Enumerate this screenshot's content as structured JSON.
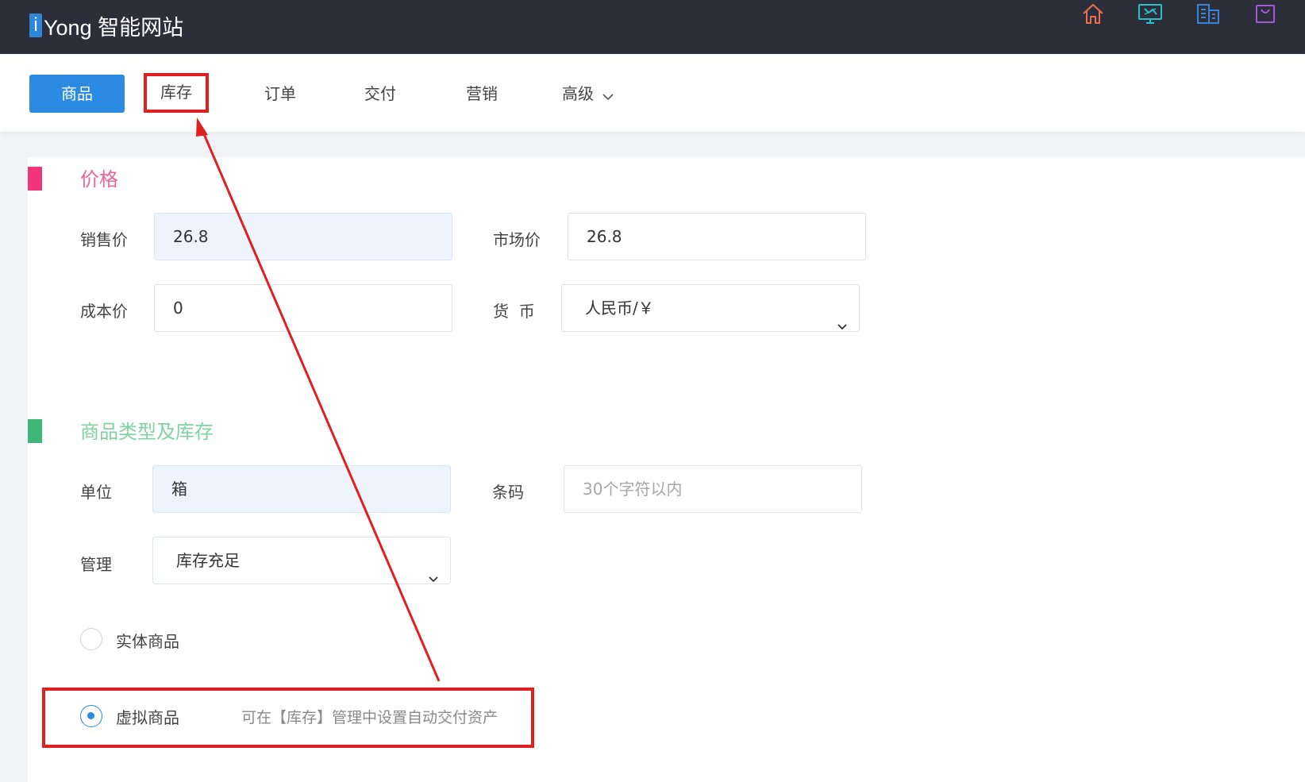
{
  "brand": {
    "logo_letter": "i",
    "name": "Yong 智能网站"
  },
  "top_icons": [
    "home-icon",
    "dashboard-monitor-icon",
    "building-icon",
    "shopping-bag-icon"
  ],
  "colors": {
    "topbar": "#2c2e3a",
    "accent": "#2b8be2",
    "price_section": "#f0357a",
    "stock_section": "#3cb878",
    "price_title": "#e8669a",
    "stock_title": "#7fd3a2",
    "annotation": "#e02020"
  },
  "nav": {
    "tabs": [
      {
        "label": "商品",
        "active": true
      },
      {
        "label": "库存",
        "active": false
      },
      {
        "label": "订单",
        "active": false
      },
      {
        "label": "交付",
        "active": false
      },
      {
        "label": "营销",
        "active": false
      },
      {
        "label": "高级",
        "active": false
      }
    ]
  },
  "price": {
    "title": "价格",
    "sale_label": "销售价",
    "sale_value": "26.8",
    "market_label": "市场价",
    "market_value": "26.8",
    "cost_label": "成本价",
    "cost_value": "0",
    "currency_label": "货  币",
    "currency_value": "人民币/￥"
  },
  "stock": {
    "title": "商品类型及库存",
    "unit_label": "单位",
    "unit_value": "箱",
    "barcode_label": "条码",
    "barcode_placeholder": "30个字符以内",
    "manage_label": "管理",
    "manage_value": "库存充足",
    "physical_label": "实体商品",
    "virtual_label": "虚拟商品",
    "virtual_hint": "可在【库存】管理中设置自动交付资产",
    "selected": "virtual"
  }
}
